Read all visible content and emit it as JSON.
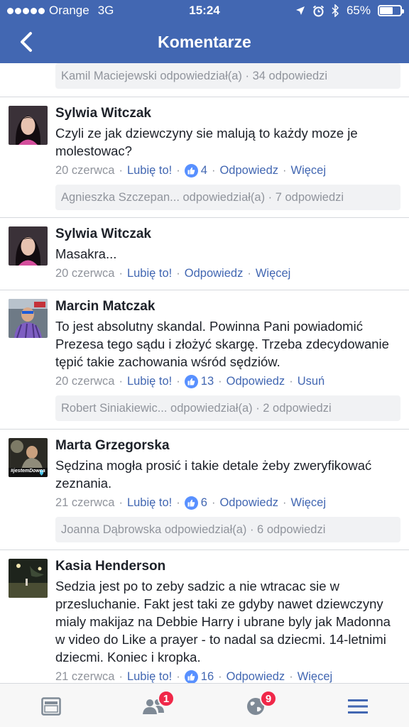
{
  "status_bar": {
    "carrier": "Orange",
    "network": "3G",
    "time": "15:24",
    "battery": "65%",
    "battery_level": 0.65
  },
  "header": {
    "title": "Komentarze"
  },
  "top_reply_bar": "Kamil Maciejewski odpowiedział(a) · 34 odpowiedzi",
  "comments": [
    {
      "author": "Sylwia Witczak",
      "text": "Czyli ze jak dziewczyny sie malują to każdy moze je molestowac?",
      "date": "20 czerwca",
      "like_label": "Lubię to!",
      "like_count": "4",
      "reply_label": "Odpowiedz",
      "more_label": "Więcej",
      "replies": "Agnieszka Szczepan... odpowiedział(a) · 7 odpowiedzi"
    },
    {
      "author": "Sylwia Witczak",
      "text": "Masakra...",
      "date": "20 czerwca",
      "like_label": "Lubię to!",
      "reply_label": "Odpowiedz",
      "more_label": "Więcej"
    },
    {
      "author": "Marcin Matczak",
      "text": "To jest absolutny skandal. Powinna Pani powiadomić Prezesa tego sądu i złożyć skargę. Trzeba zdecydowanie tępić takie zachowania wśród sędziów.",
      "date": "20 czerwca",
      "like_label": "Lubię to!",
      "like_count": "13",
      "reply_label": "Odpowiedz",
      "more_label": "Usuń",
      "replies": "Robert Siniakiewic... odpowiedział(a) · 2 odpowiedzi"
    },
    {
      "author": "Marta Grzegorska",
      "text": "Sędzina mogła prosić i takie detale żeby zweryfikować zeznania.",
      "date": "21 czerwca",
      "like_label": "Lubię to!",
      "like_count": "6",
      "reply_label": "Odpowiedz",
      "more_label": "Więcej",
      "replies": "Joanna Dąbrowska odpowiedział(a) · 6 odpowiedzi",
      "avatar_caption": "#jestemDowca"
    },
    {
      "author": "Kasia Henderson",
      "text": "Sedzia jest po to zeby sadzic a nie wtracac sie w przesluchanie. Fakt jest taki ze gdyby nawet dziewczyny mialy makijaz na Debbie Harry i ubrane byly jak Madonna w video do Like a prayer - to nadal sa dziecmi. 14-letnimi dziecmi. Koniec i kropka.",
      "date": "21 czerwca",
      "like_label": "Lubię to!",
      "like_count": "16",
      "reply_label": "Odpowiedz",
      "more_label": "Więcej"
    }
  ],
  "tab_bar": {
    "friends_badge": "1",
    "notifications_badge": "9"
  },
  "colors": {
    "brand": "#4267b2",
    "like": "#5890ff",
    "badge": "#f02849",
    "meta": "#90949c"
  },
  "icons": [
    "back-chevron-icon",
    "location-arrow-icon",
    "alarm-icon",
    "bluetooth-icon",
    "battery-icon",
    "like-thumb-icon",
    "news-feed-icon",
    "friends-icon",
    "globe-icon",
    "menu-icon"
  ]
}
